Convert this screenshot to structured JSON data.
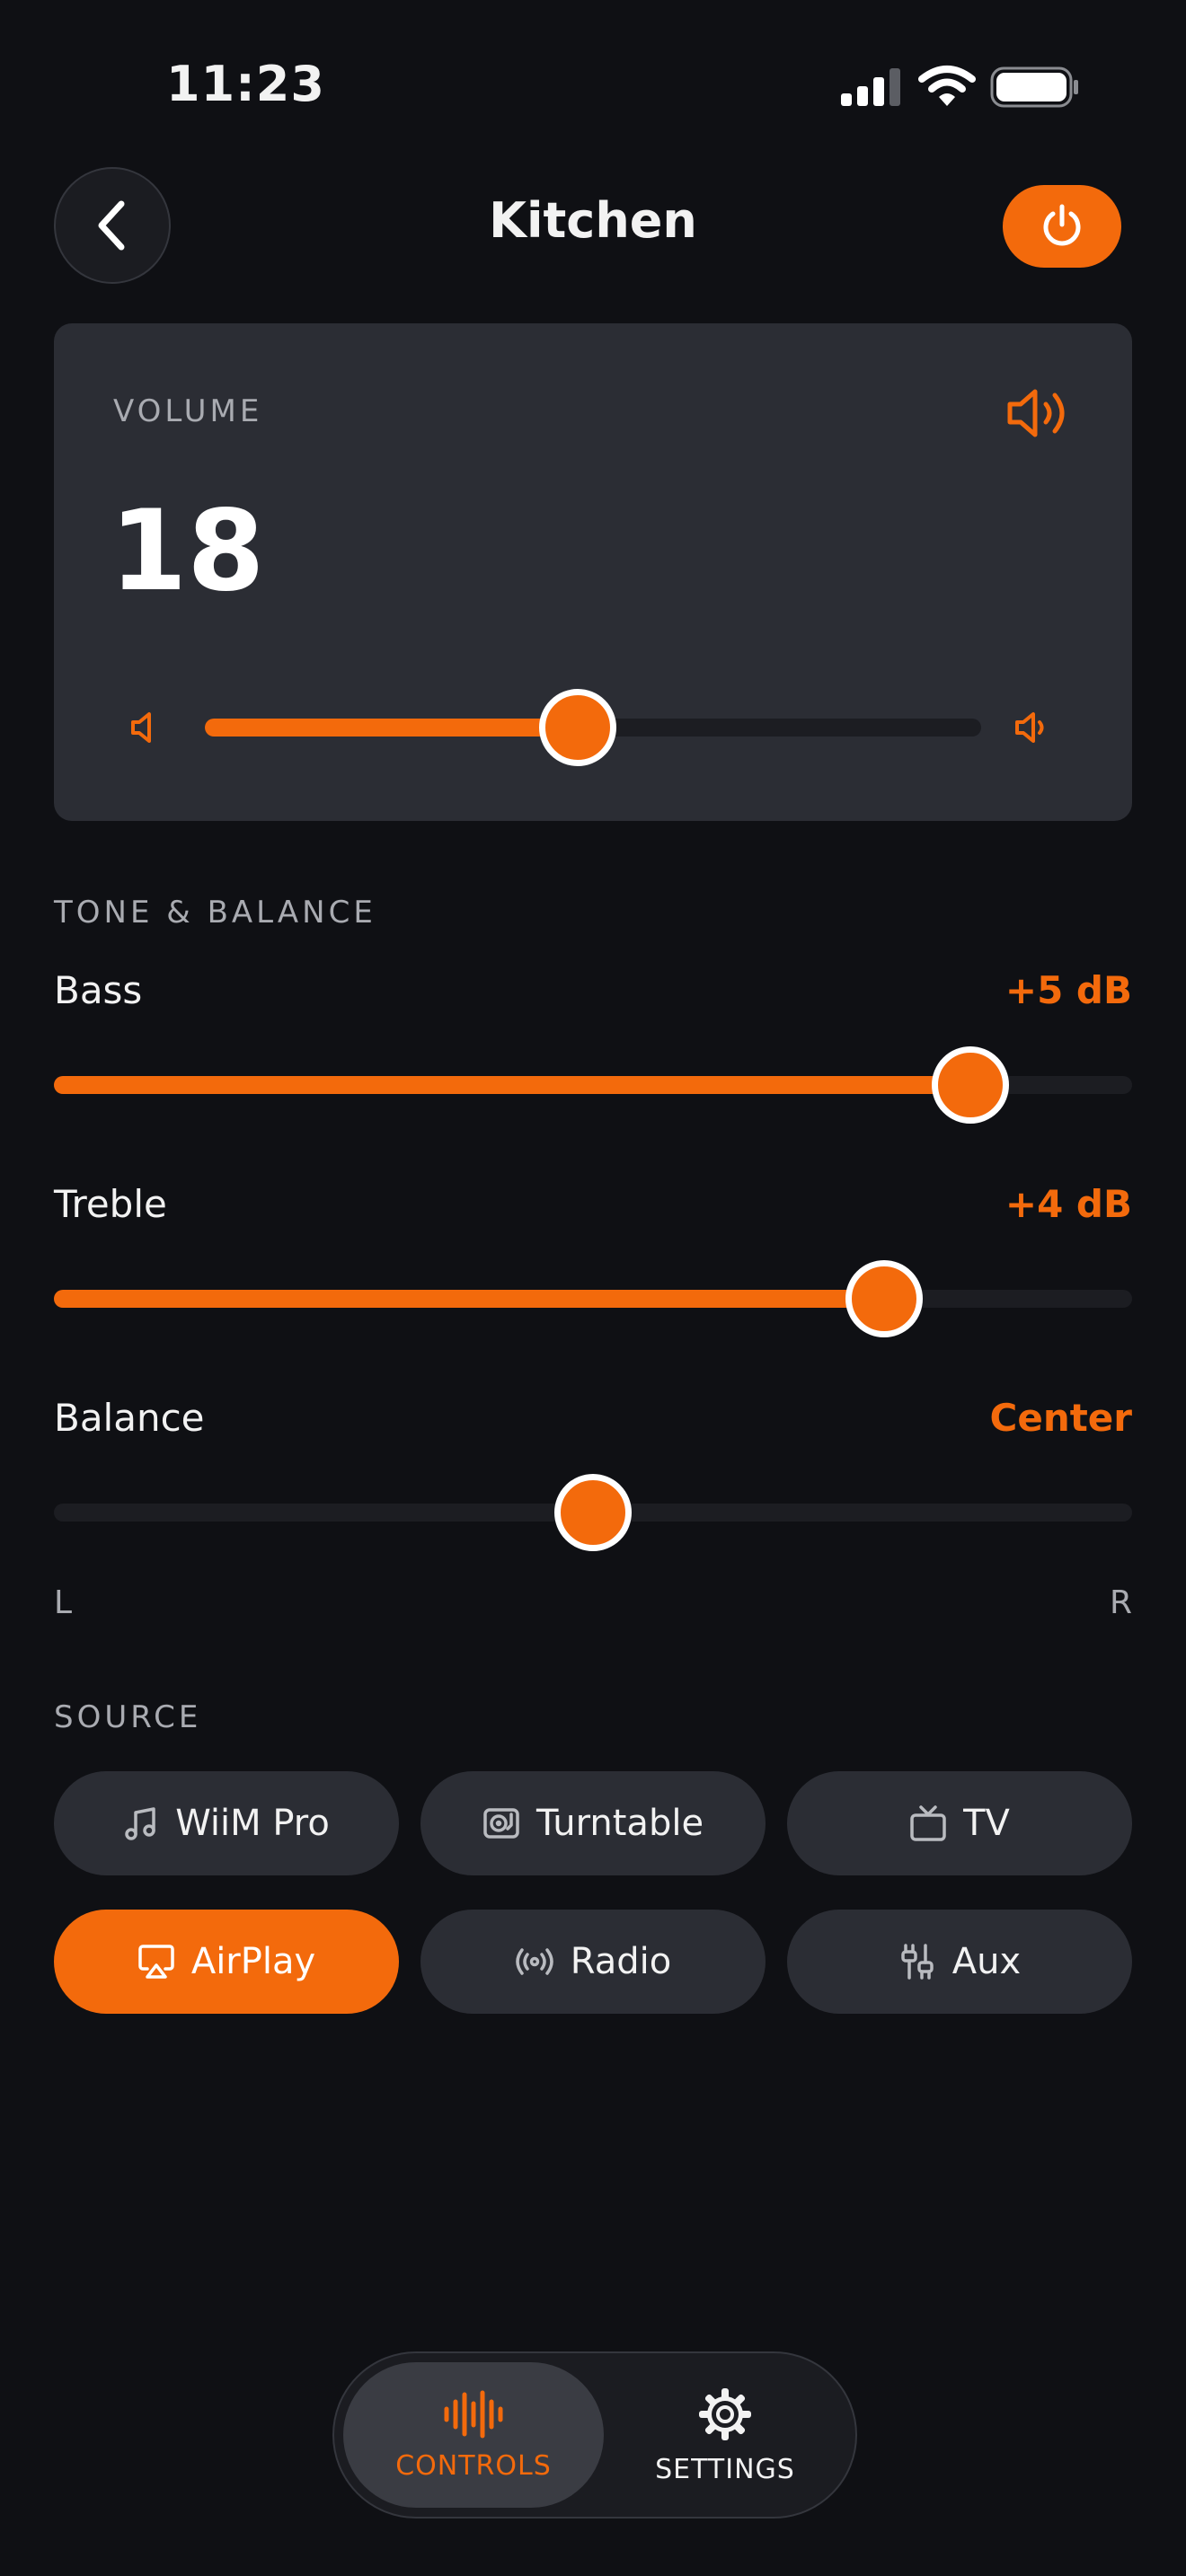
{
  "status_bar": {
    "time": "11:23"
  },
  "header": {
    "title": "Kitchen"
  },
  "volume": {
    "label": "VOLUME",
    "value": "18",
    "level": 0.48
  },
  "tone": {
    "section_label": "TONE & BALANCE",
    "bass": {
      "label": "Bass",
      "value": "+5 dB",
      "level": 0.85
    },
    "treble": {
      "label": "Treble",
      "value": "+4 dB",
      "level": 0.77
    },
    "balance": {
      "label": "Balance",
      "value": "Center",
      "level": 0.5,
      "left": "L",
      "right": "R"
    }
  },
  "source": {
    "section_label": "SOURCE",
    "chips": [
      {
        "label": "WiiM Pro",
        "icon": "music-note-icon",
        "active": false
      },
      {
        "label": "Turntable",
        "icon": "turntable-icon",
        "active": false
      },
      {
        "label": "TV",
        "icon": "tv-icon",
        "active": false
      },
      {
        "label": "AirPlay",
        "icon": "airplay-icon",
        "active": true
      },
      {
        "label": "Radio",
        "icon": "radio-icon",
        "active": false
      },
      {
        "label": "Aux",
        "icon": "aux-cable-icon",
        "active": false
      }
    ]
  },
  "tabbar": {
    "controls_label": "CONTROLS",
    "settings_label": "SETTINGS",
    "active": "controls"
  },
  "colors": {
    "accent": "#f36a0c",
    "background": "#0f1014",
    "card": "#2b2d34"
  }
}
